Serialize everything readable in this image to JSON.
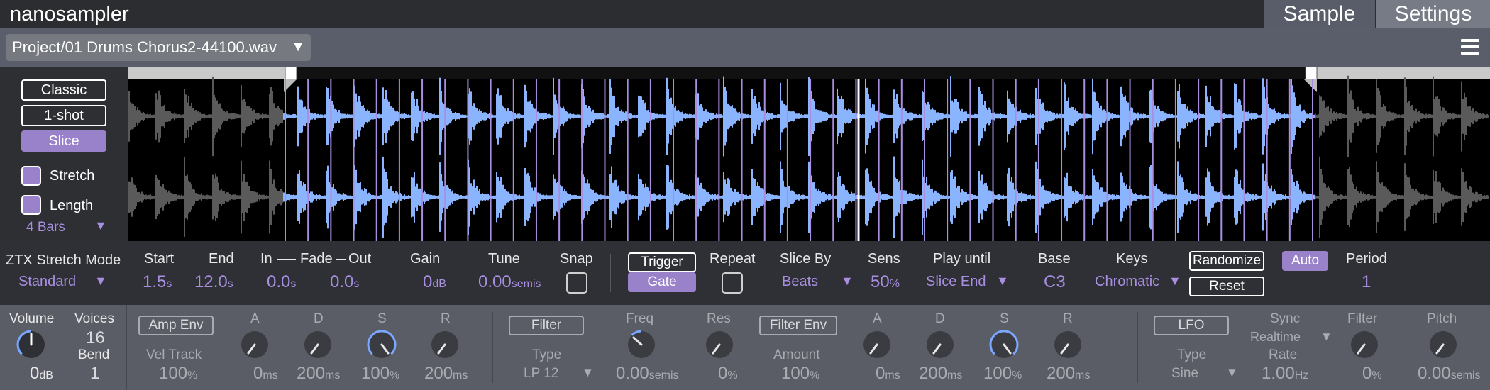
{
  "app": {
    "title": "nanosampler"
  },
  "tabs": [
    {
      "label": "Sample",
      "active": true
    },
    {
      "label": "Settings",
      "active": false
    }
  ],
  "file": {
    "name": "Project/01 Drums Chorus2-44100.wav",
    "arrow": "▼"
  },
  "modes": [
    {
      "label": "Classic"
    },
    {
      "label": "1-shot"
    },
    {
      "label": "Slice"
    }
  ],
  "active_mode": "Slice",
  "options": {
    "stretch_label": "Stretch",
    "length_label": "Length",
    "length_value": "4 Bars",
    "dropdown_arrow": "▼"
  },
  "stretch_mode": {
    "label": "ZTX Stretch Mode",
    "value": "Standard"
  },
  "params": {
    "start": {
      "label": "Start",
      "value": "1.5",
      "unit": "s"
    },
    "end": {
      "label": "End",
      "value": "12.0",
      "unit": "s"
    },
    "fade_header": {
      "in": "In",
      "fade": "Fade",
      "out": "Out"
    },
    "fade_in": {
      "value": "0.0",
      "unit": "s"
    },
    "fade_out": {
      "value": "0.0",
      "unit": "s"
    },
    "gain": {
      "label": "Gain",
      "value": "0",
      "unit": "dB"
    },
    "tune": {
      "label": "Tune",
      "value": "0.00",
      "unit": "semis"
    },
    "snap": {
      "label": "Snap"
    },
    "trigger": {
      "label": "Trigger"
    },
    "gate": {
      "label": "Gate"
    },
    "repeat": {
      "label": "Repeat"
    },
    "slice_by": {
      "label": "Slice By",
      "value": "Beats"
    },
    "sens": {
      "label": "Sens",
      "value": "50",
      "unit": "%"
    },
    "play_until": {
      "label": "Play until",
      "value": "Slice End"
    },
    "base": {
      "label": "Base",
      "value": "C3"
    },
    "keys": {
      "label": "Keys",
      "value": "Chromatic"
    },
    "randomize": {
      "label": "Randomize"
    },
    "auto": {
      "label": "Auto"
    },
    "reset": {
      "label": "Reset"
    },
    "period": {
      "label": "Period",
      "value": "1"
    }
  },
  "bottom": {
    "volume": {
      "label": "Volume",
      "value": "0",
      "unit": "dB"
    },
    "voices": {
      "label": "Voices",
      "value": "16"
    },
    "bend": {
      "label": "Bend",
      "value": "1"
    },
    "amp_env": {
      "label": "Amp Env",
      "vel_track_label": "Vel Track",
      "vel_track_value": "100",
      "vel_track_unit": "%"
    },
    "amp": {
      "a": {
        "label": "A",
        "value": "0",
        "unit": "ms"
      },
      "d": {
        "label": "D",
        "value": "200",
        "unit": "ms"
      },
      "s": {
        "label": "S",
        "value": "100",
        "unit": "%"
      },
      "r": {
        "label": "R",
        "value": "200",
        "unit": "ms"
      }
    },
    "filter": {
      "label": "Filter",
      "type_label": "Type",
      "type_value": "LP 12",
      "freq_label": "Freq",
      "freq_value": "0.00",
      "freq_unit": "semis",
      "res_label": "Res",
      "res_value": "0",
      "res_unit": "%"
    },
    "filter_env": {
      "label": "Filter Env",
      "amount_label": "Amount",
      "amount_value": "100",
      "amount_unit": "%"
    },
    "fenv": {
      "a": {
        "label": "A",
        "value": "0",
        "unit": "ms"
      },
      "d": {
        "label": "D",
        "value": "200",
        "unit": "ms"
      },
      "s": {
        "label": "S",
        "value": "100",
        "unit": "%"
      },
      "r": {
        "label": "R",
        "value": "200",
        "unit": "ms"
      }
    },
    "lfo": {
      "label": "LFO",
      "type_label": "Type",
      "type_value": "Sine",
      "sync_label": "Sync",
      "sync_value": "Realtime",
      "rate_label": "Rate",
      "rate_value": "1.00",
      "rate_unit": "Hz",
      "filter_label": "Filter",
      "filter_value": "0",
      "filter_unit": "%",
      "pitch_label": "Pitch",
      "pitch_value": "0.00",
      "pitch_unit": "semis"
    }
  },
  "waveform": {
    "slice_count": 46,
    "playhead_fraction": 0.45
  }
}
